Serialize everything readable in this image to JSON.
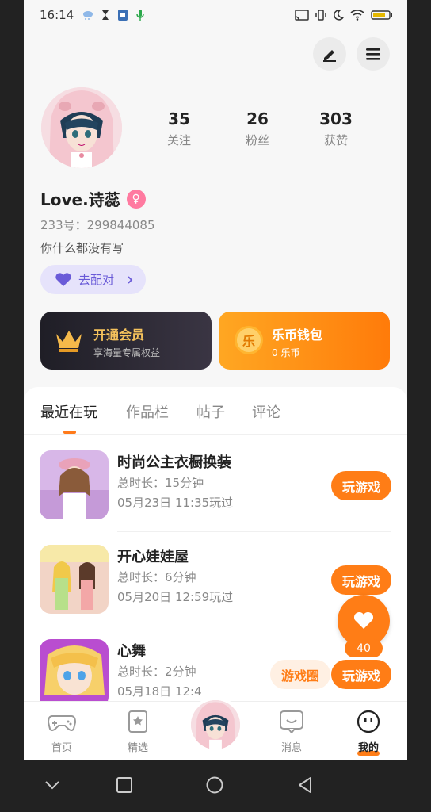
{
  "status_bar": {
    "time": "16:14"
  },
  "profile": {
    "stats": [
      {
        "num": "35",
        "label": "关注"
      },
      {
        "num": "26",
        "label": "粉丝"
      },
      {
        "num": "303",
        "label": "获赞"
      }
    ],
    "username": "Love.诗蕊",
    "uid": "233号：299844085",
    "bio": "你什么都没有写",
    "match_label": "去配对"
  },
  "cards": {
    "vip": {
      "title": "开通会员",
      "sub": "享海量专属权益"
    },
    "wallet": {
      "title": "乐币钱包",
      "sub": "0 乐币",
      "coin_glyph": "乐"
    }
  },
  "tabs": [
    "最近在玩",
    "作品栏",
    "帖子",
    "评论"
  ],
  "games": [
    {
      "title": "时尚公主衣橱换装",
      "duration": "总时长：15分钟",
      "date": "05月23日 11:35玩过",
      "play": "玩游戏"
    },
    {
      "title": "开心娃娃屋",
      "duration": "总时长：6分钟",
      "date": "05月20日 12:59玩过",
      "play": "玩游戏"
    },
    {
      "title": "心舞",
      "duration": "总时长：2分钟",
      "date": "05月18日 12:4",
      "play": "玩游戏",
      "circle": "游戏圈"
    }
  ],
  "fab": {
    "count": "40"
  },
  "nav": {
    "home": "首页",
    "featured": "精选",
    "messages": "消息",
    "mine": "我的"
  },
  "colors": {
    "accent": "#ff7d16",
    "purple": "#6a5bd8"
  }
}
